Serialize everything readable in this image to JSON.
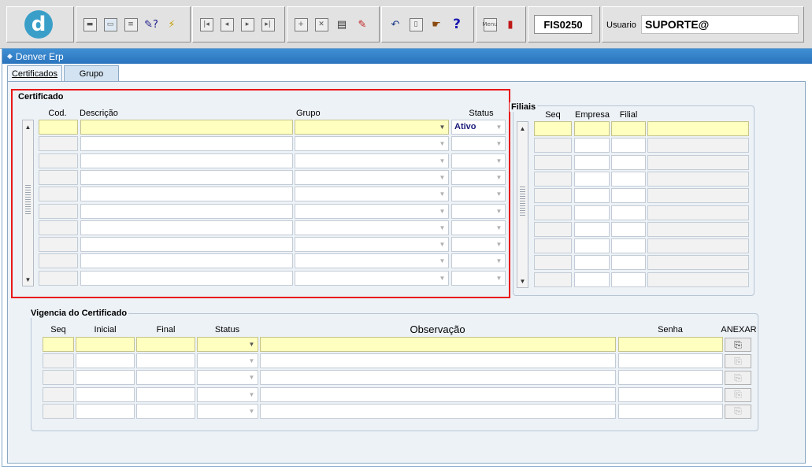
{
  "toolbar": {
    "form_code": "FIS0250",
    "user_label": "Usuario",
    "user_value": "SUPORTE@",
    "groups": [
      {
        "buttons": [
          "save-icon",
          "screen-icon",
          "print-icon",
          "query-help-icon",
          "execute-query-icon"
        ]
      },
      {
        "buttons": [
          "first-record-icon",
          "previous-record-icon",
          "next-record-icon",
          "last-record-icon"
        ]
      },
      {
        "buttons": [
          "insert-record-icon",
          "delete-record-icon",
          "edit-icon",
          "clear-icon"
        ]
      },
      {
        "buttons": [
          "undo-icon",
          "clipboard-icon",
          "hand-icon",
          "help-icon"
        ]
      },
      {
        "buttons": [
          "menu-icon",
          "exit-icon"
        ]
      }
    ]
  },
  "window": {
    "title": "Denver Erp",
    "tabs": [
      {
        "label": "Certificados",
        "active": true
      },
      {
        "label": "Grupo",
        "active": false
      }
    ]
  },
  "certificado": {
    "title": "Certificado",
    "columns": {
      "cod": "Cod.",
      "descricao": "Descrição",
      "grupo": "Grupo",
      "status": "Status"
    },
    "first_row_status": "Ativo",
    "row_count": 10
  },
  "filiais": {
    "title": "Filiais",
    "columns": {
      "seq": "Seq",
      "empresa": "Empresa",
      "filial": "Filial"
    },
    "row_count": 10
  },
  "vigencia": {
    "title": "Vigencia do Certificado",
    "columns": {
      "seq": "Seq",
      "inicial": "Inicial",
      "final": "Final",
      "status": "Status",
      "observacao": "Observação",
      "senha": "Senha",
      "anexar": "ANEXAR"
    },
    "row_count": 5
  },
  "colors": {
    "title_bar": "#2f7fc6",
    "current_row": "#ffffc0",
    "highlight_border": "#e81818"
  }
}
